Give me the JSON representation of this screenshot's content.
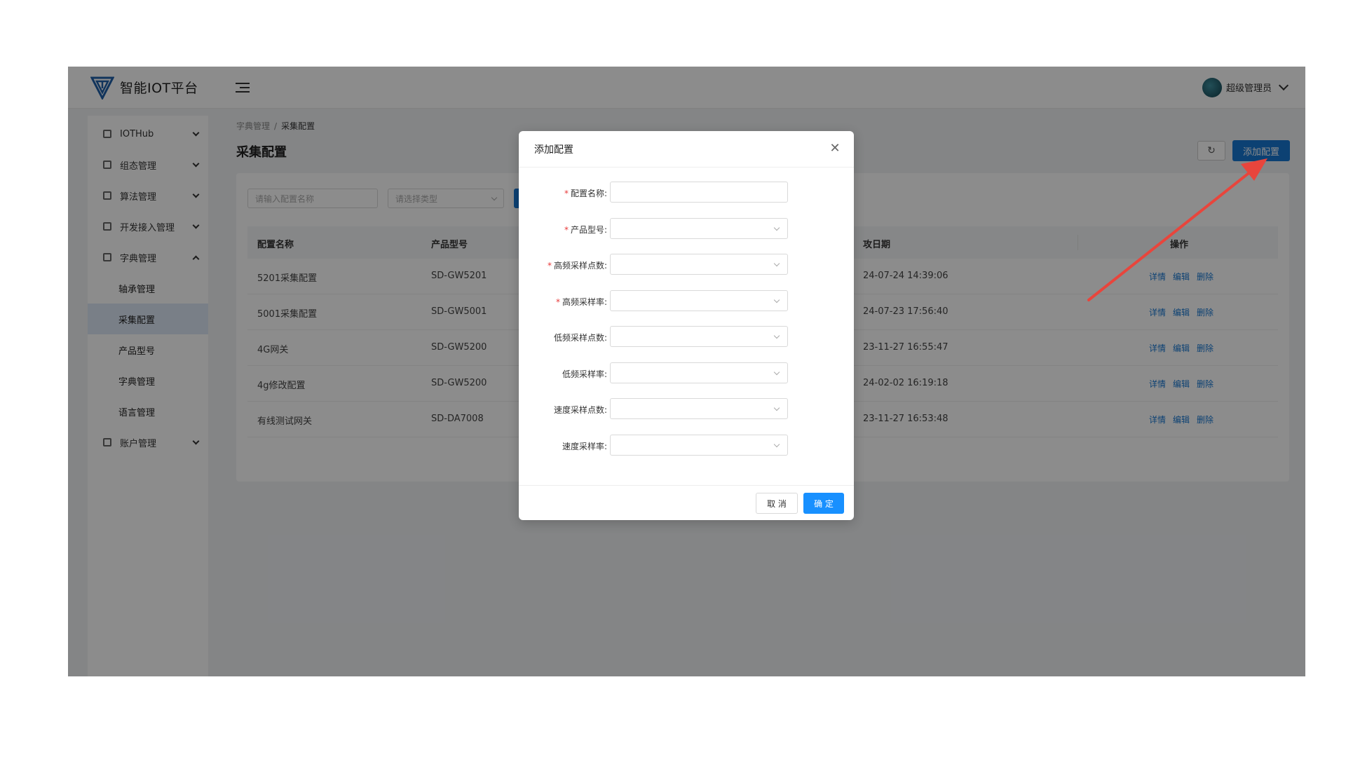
{
  "header": {
    "brand": "智能IOT平台",
    "user_name": "超级管理员"
  },
  "sidebar": {
    "items": [
      {
        "label": "IOTHub",
        "icon": "grid-icon",
        "expanded": false
      },
      {
        "label": "组态管理",
        "icon": "layers-icon",
        "expanded": false
      },
      {
        "label": "算法管理",
        "icon": "algorithm-icon",
        "expanded": false
      },
      {
        "label": "开发接入管理",
        "icon": "dev-icon",
        "expanded": false
      },
      {
        "label": "字典管理",
        "icon": "chart-icon",
        "expanded": true
      },
      {
        "label": "账户管理",
        "icon": "account-icon",
        "expanded": false
      }
    ],
    "sub_items": [
      {
        "label": "轴承管理",
        "active": false
      },
      {
        "label": "采集配置",
        "active": true
      },
      {
        "label": "产品型号",
        "active": false
      },
      {
        "label": "字典管理",
        "active": false
      },
      {
        "label": "语言管理",
        "active": false
      }
    ]
  },
  "breadcrumb": {
    "parent": "字典管理",
    "separator": "/",
    "current": "采集配置"
  },
  "page": {
    "title": "采集配置",
    "refresh_icon": "refresh-icon",
    "add_button": "添加配置"
  },
  "filters": {
    "name_placeholder": "请输入配置名称",
    "type_placeholder": "请选择类型"
  },
  "table": {
    "columns": [
      "配置名称",
      "产品型号",
      "攻日期",
      "操作"
    ],
    "rows": [
      {
        "name": "5201采集配置",
        "model": "SD-GW5201",
        "date": "24-07-24 14:39:06"
      },
      {
        "name": "5001采集配置",
        "model": "SD-GW5001",
        "date": "24-07-23 17:56:40"
      },
      {
        "name": "4G网关",
        "model": "SD-GW5200",
        "date": "23-11-27 16:55:47"
      },
      {
        "name": "4g修改配置",
        "model": "SD-GW5200",
        "date": "24-02-02 16:19:18"
      },
      {
        "name": "有线测试网关",
        "model": "SD-DA7008",
        "date": "23-11-27 16:53:48"
      }
    ],
    "ops": [
      "详情",
      "编辑",
      "删除"
    ]
  },
  "modal": {
    "title": "添加配置",
    "fields": [
      {
        "label": "配置名称:",
        "required": true,
        "type": "input",
        "value": ""
      },
      {
        "label": "产品型号:",
        "required": true,
        "type": "select",
        "value": ""
      },
      {
        "label": "高频采样点数:",
        "required": true,
        "type": "select",
        "value": ""
      },
      {
        "label": "高频采样率:",
        "required": true,
        "type": "select",
        "value": ""
      },
      {
        "label": "低频采样点数:",
        "required": false,
        "type": "select",
        "value": ""
      },
      {
        "label": "低频采样率:",
        "required": false,
        "type": "select",
        "value": ""
      },
      {
        "label": "速度采样点数:",
        "required": false,
        "type": "select",
        "value": ""
      },
      {
        "label": "速度采样率:",
        "required": false,
        "type": "select",
        "value": ""
      }
    ],
    "cancel": "取 消",
    "ok": "确 定"
  },
  "colors": {
    "primary": "#1677d2",
    "required": "#e83a3a",
    "annotation_arrow": "#e8453c"
  }
}
